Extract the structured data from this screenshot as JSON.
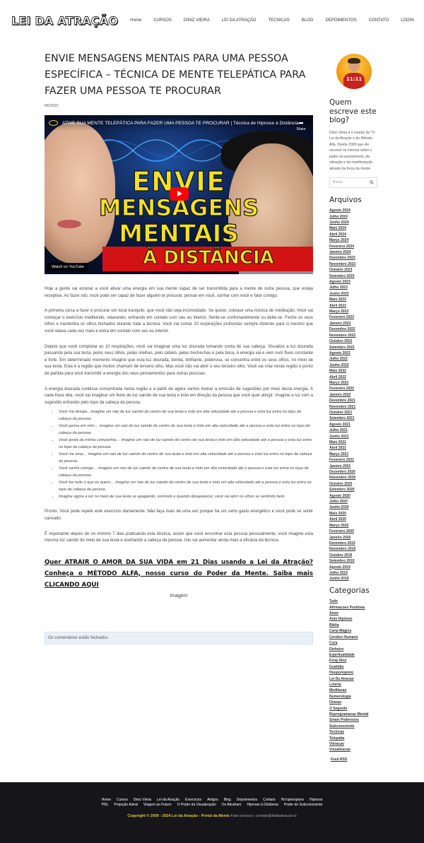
{
  "site": {
    "logo": "LEI DA ATRAÇÃO",
    "nav": [
      "Home",
      "CURSOS",
      "DINIZ VIEIRA",
      "LEI DA ATRAÇÃO",
      "TECNICAS",
      "BLOG",
      "DEPOIMENTOS",
      "CONTATO",
      "LOGIN"
    ]
  },
  "post": {
    "title": "ENVIE MENSAGENS MENTAIS PARA UMA PESSOA ESPECÍFICA – TÉCNICA DE MENTE TELEPÁTICA PARA FAZER UMA PESSOA TE PROCURAR",
    "date": "8/6/2022",
    "video": {
      "title": "ATIVE SUA MENTE TELEPÁTICA PARA FAZER UMA PESSOA TE PROCURAR | Técnica de Hipnose à Distância",
      "share": "Share",
      "line1": "ENVIE",
      "line2": "MENSAGENS",
      "line3": "MENTAIS",
      "line4": "À DISTÂNCIA",
      "watch": "Watch on YouTube"
    },
    "paragraphs": [
      "Hoje a gente vai ensinar a você ativar uma energia em sua mente capaz de ser transmitida para a mente de outra pessoa, que esteja receptiva. Ao fazer isto, você pode ser capaz de fazer alguém te procurar, pensar em você, sonhar com você e falar contigo.",
      "A primeira coisa a fazer é procurar um local tranquilo, que você não seja incomodado. Se quiser, coloque uma música de meditação. Você vai começar o exercício meditando, relaxando; entrando em contato com seu eu interior. Sente-se confortavelmente ou deite-se. Feche os seus olhos e mantenha os olhos fechados durante toda a técnica. Você vai contar 10 respirações profundas sempre dizendo para si mesmo que você relaxa cada vez mais e entra em contato com seu eu interior.",
      "Depois que você completar as 10 respirações, você vai imaginar uma luz dourada tomando conta de sua cabeça. Visualize a luz dourada passando pela sua testa, pelos seus olhos, pelas orelhas, pelo cabelo, pelas bochechas e pela boca. A energia vai e vem num fluxo constante e forte. Em determinado momento imagine que esta luz dourada, bonita, brilhante, poderosa, se concentra entre os seus olhos, no meio de sua testa. Esta é a região que muitos chamam de terceiro olho. Mas você não vai abrir o seu terceiro olho. Você vai criar nesta região o ponto de partida para você transmitir a energia dos seus pensamentos para outras pessoas.",
      "A energia dourada continua concentrada nesta região e a partir de agora vamos treinar a emissão de sugestões por meio desta energia. A cada frase dita, você vai imaginar um feixe de luz saindo de sua testa e indo em direção da pessoa que você quer atingir. Imagine a luz com a sugestão entrando pelo topo da cabeça da pessoa."
    ],
    "bullets": [
      "Você me deseja…imagine um raio de luz saindo do centro de sua testa e indo em alta velocidade até a pessoa e esta luz entra no topo da cabeça da pessoa.",
      "Você pensa em mim… imagine um raio de luz saindo do centro de sua testa e indo em alta velocidade até a pessoa e esta luz entra no topo da cabeça da pessoa.",
      "Você gosta da minha companhia… imagine um raio de luz saindo do centro de sua testa e indo em alta velocidade até a pessoa e esta luz entra no topo da cabeça da pessoa.",
      "Você me ama… imagine um raio de luz saindo do centro de sua testa e indo em alta velocidade até a pessoa e esta luz entra no topo da cabeça da pessoa.",
      "Você sonha comigo… imagine um raio de luz saindo do centro de sua testa e indo em alta velocidade até a pessoa e esta luz entra no topo da cabeça da pessoa.",
      "Você faz tudo o que eu quero… imagine um raio de luz saindo do centro de sua testa e indo em alta velocidade até a pessoa e esta luz entra no topo da cabeça da pessoa.",
      "Imagine agora a luz no meio de sua testa se apagando, sumindo e quando desaparecer, você vai abrir os olhos se sentindo bem."
    ],
    "after": [
      "Pronto. Você pode repetir este exercício diariamente. Não faça mais de uma vez porque há um certo gasto energético e você pode se sentir cansado.",
      "É importante depois de no mínimo 7 dias praticando esta técnica, assim que você encontrar esta pessoa pessoalmente, você imagine esta mesma luz saindo do meio de sua testa e acertando a cabeça da pessoa. Isto vai aumentar ainda mais a eficácia da técnica."
    ],
    "cta": "Quer ATRAIR O AMOR DA SUA VIDA em 21 Dias usando a Lei da Atração? Conheça o MÉTODO ALFA, nosso curso do Poder da Mente. Saiba mais CLICANDO AQUI",
    "image_alt": "Imagem",
    "comments_closed": "Os comentários estão fechados."
  },
  "sidebar": {
    "about_title": "Quem escreve este blog?",
    "about_text": "Diniz Vieira é o criador da TV Lei da Atração e do Método Alfa. Desde 2009 que ele escreve na internet sobre o poder do pensamento, da vibração e da manifestação através da força da mente.",
    "avatar_text": "11:11",
    "search_placeholder": "Busca",
    "archives_title": "Arquivos",
    "archives": [
      "Agosto 2024",
      "Julho 2024",
      "Junho 2024",
      "Maio 2024",
      "Abril 2024",
      "Março 2024",
      "Fevereiro 2024",
      "Janeiro 2024",
      "Dezembro 2023",
      "Novembro 2023",
      "Outubro 2023",
      "Setembro 2023",
      "Agosto 2023",
      "Julho 2023",
      "Junho 2023",
      "Maio 2023",
      "Abril 2023",
      "Março 2023",
      "Fevereiro 2023",
      "Janeiro 2023",
      "Dezembro 2022",
      "Novembro 2022",
      "Outubro 2022",
      "Setembro 2022",
      "Agosto 2022",
      "Julho 2022",
      "Junho 2022",
      "Maio 2022",
      "Abril 2022",
      "Março 2022",
      "Fevereiro 2022",
      "Janeiro 2022",
      "Dezembro 2021",
      "Novembro 2021",
      "Outubro 2021",
      "Setembro 2021",
      "Agosto 2021",
      "Julho 2021",
      "Junho 2021",
      "Maio 2021",
      "Abril 2021",
      "Março 2021",
      "Fevereiro 2021",
      "Janeiro 2021",
      "Dezembro 2020",
      "Novembro 2020",
      "Outubro 2020",
      "Setembro 2020",
      "Agosto 2020",
      "Julho 2020",
      "Junho 2020",
      "Maio 2020",
      "Abril 2020",
      "Março 2020",
      "Fevereiro 2020",
      "Janeiro 2020",
      "Dezembro 2019",
      "Novembro 2019",
      "Outubro 2019",
      "Setembro 2019",
      "Agosto 2019",
      "Julho 2019",
      "Junho 2019"
    ],
    "categories_title": "Categorias",
    "categories": [
      "Tudo",
      "Afirmacoes Positivas",
      "Amor",
      "Auto Hipnose",
      "Bíblia",
      "Carta Mágica",
      "Cerebro Humano",
      "Cura",
      "Dinheiro",
      "Espiritualidade",
      "Feng Shui",
      "Gratidão",
      "Hooponopono",
      "Lei Da Atracao",
      "Loteria",
      "Meditacao",
      "Numerologia",
      "Oracao",
      "O Segredo",
      "Reprogramacao Mental",
      "Sinais Poderosos",
      "Subconsciente",
      "Tecnicas",
      "Telepatia",
      "Vibracao",
      "Visualizacao"
    ],
    "feed": "Feed RSS"
  },
  "footer": {
    "row1": [
      "Home",
      "Cursos",
      "Diniz Vieira",
      "Lei da Atração",
      "Exercícios",
      "Artigos",
      "Blog",
      "Depoimentos",
      "Contato",
      "Ho'oponopono",
      "Hipnose"
    ],
    "row2": [
      "PNL",
      "Projeção Astral",
      "Viagem ao Futuro",
      "O Poder da Visualização",
      "Os Abraham",
      "Hipnose à Distância",
      "Poder do Subconsciente"
    ],
    "copyright": "Copyright © 2009 - 2024 Lei da Atração - Portal da Mente",
    "contact": "Fale conosco: contato@leidaatracao.tv"
  },
  "colors": {
    "footer_bg": "#16161a",
    "copyright_yellow": "#e8c43a",
    "play_red": "#ff0000",
    "thumb_yellow": "#f4e023",
    "band_red": "#d21313"
  }
}
